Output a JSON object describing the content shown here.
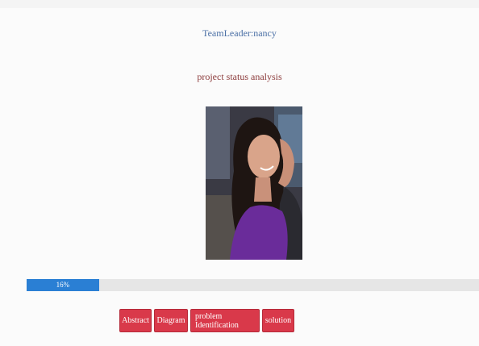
{
  "header": {
    "title": "TeamLeader:nancy",
    "subtitle": "project status analysis"
  },
  "photo": {
    "description_icon": "person-photo"
  },
  "progress": {
    "label": "16%",
    "value": 0.16
  },
  "actions": {
    "abstract_label": "Abstract",
    "diagram_label": "Diagram",
    "problem_label": "problem Identification",
    "solution_label": "solution",
    "button_color": "#d9394a"
  }
}
